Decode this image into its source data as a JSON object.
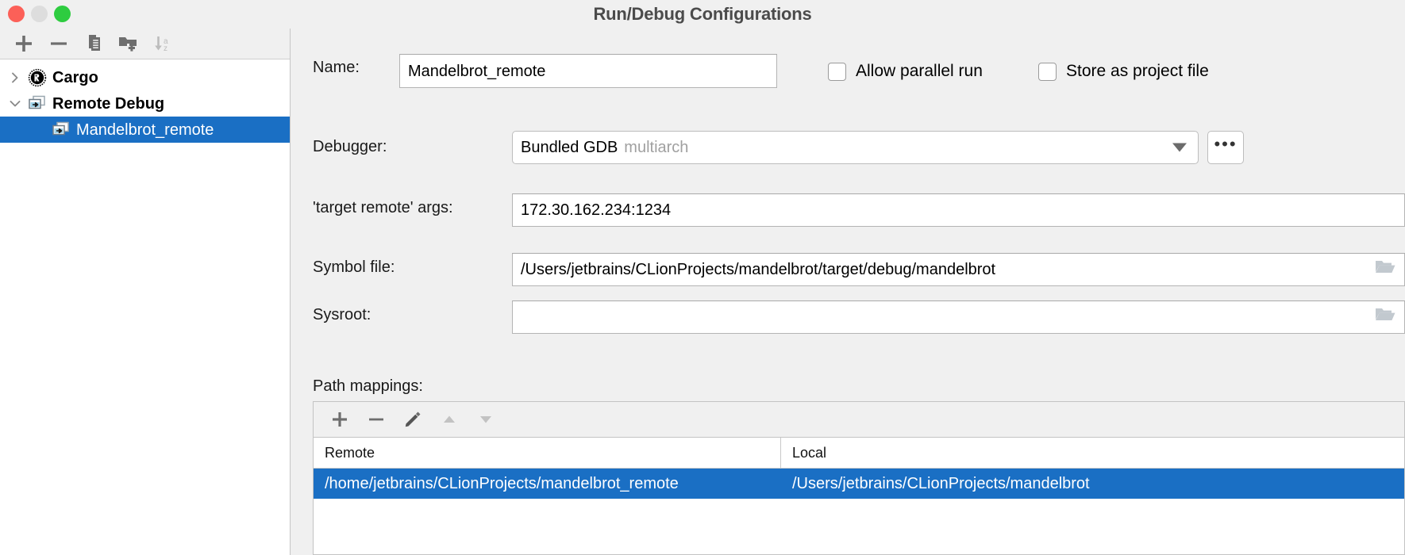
{
  "window": {
    "title": "Run/Debug Configurations",
    "traffic_lights": [
      {
        "name": "close",
        "color": "#fc6058"
      },
      {
        "name": "minimize",
        "color": "#dddddd"
      },
      {
        "name": "zoom",
        "color": "#2ecc40"
      }
    ]
  },
  "left_panel": {
    "toolbar": [
      {
        "icon": "add-icon",
        "label": "Add New Configuration",
        "enabled": true
      },
      {
        "icon": "remove-icon",
        "label": "Remove Configuration",
        "enabled": true
      },
      {
        "icon": "copy-icon",
        "label": "Copy Configuration",
        "enabled": true
      },
      {
        "icon": "new-folder-icon",
        "label": "Create New Folder",
        "enabled": true
      },
      {
        "icon": "sort-alphabetically-icon",
        "label": "Sort Configurations",
        "enabled": false
      }
    ],
    "tree": [
      {
        "label": "Cargo",
        "icon": "rust-cargo-icon",
        "twisty": "chevron-right-icon",
        "expanded": false,
        "selected": false,
        "level": 0
      },
      {
        "label": "Remote Debug",
        "icon": "remote-debug-icon",
        "twisty": "chevron-down-icon",
        "expanded": true,
        "selected": false,
        "level": 0
      },
      {
        "label": "Mandelbrot_remote",
        "icon": "remote-debug-icon",
        "twisty": "",
        "expanded": false,
        "selected": true,
        "level": 1
      }
    ]
  },
  "form": {
    "name": {
      "label": "Name:",
      "value": "Mandelbrot_remote"
    },
    "allow_parallel_run": {
      "label": "Allow parallel run",
      "checked": false
    },
    "store_as_project_file": {
      "label": "Store as project file",
      "checked": false
    },
    "debugger": {
      "label": "Debugger:",
      "value": "Bundled GDB",
      "value_suffix": "multiarch",
      "arrow_icon": "chevron-down-icon",
      "more_button_label": "•••"
    },
    "target_remote_args": {
      "label": "'target remote' args:",
      "value": "172.30.162.234:1234"
    },
    "symbol_file": {
      "label": "Symbol file:",
      "value": "/Users/jetbrains/CLionProjects/mandelbrot/target/debug/mandelbrot",
      "browse_icon": "folder-open-icon"
    },
    "sysroot": {
      "label": "Sysroot:",
      "value": "",
      "browse_icon": "folder-open-icon"
    }
  },
  "path_mappings": {
    "label": "Path mappings:",
    "toolbar": [
      {
        "icon": "add-icon",
        "label": "Add Mapping",
        "enabled": true
      },
      {
        "icon": "remove-icon",
        "label": "Remove Mapping",
        "enabled": true
      },
      {
        "icon": "edit-pencil-icon",
        "label": "Edit Mapping",
        "enabled": true
      },
      {
        "icon": "arrow-up-icon",
        "label": "Move Up",
        "enabled": false
      },
      {
        "icon": "arrow-down-icon",
        "label": "Move Down",
        "enabled": false
      }
    ],
    "columns": [
      "Remote",
      "Local"
    ],
    "rows": [
      {
        "remote": "/home/jetbrains/CLionProjects/mandelbrot_remote",
        "local": "/Users/jetbrains/CLionProjects/mandelbrot",
        "selected": true
      }
    ]
  },
  "colors": {
    "selection_blue": "#1a6fc4",
    "window_bg": "#f0f0f0",
    "panel_bg": "#ffffff",
    "title_text": "#4b4b4b",
    "muted_text": "#a0a0a0"
  }
}
